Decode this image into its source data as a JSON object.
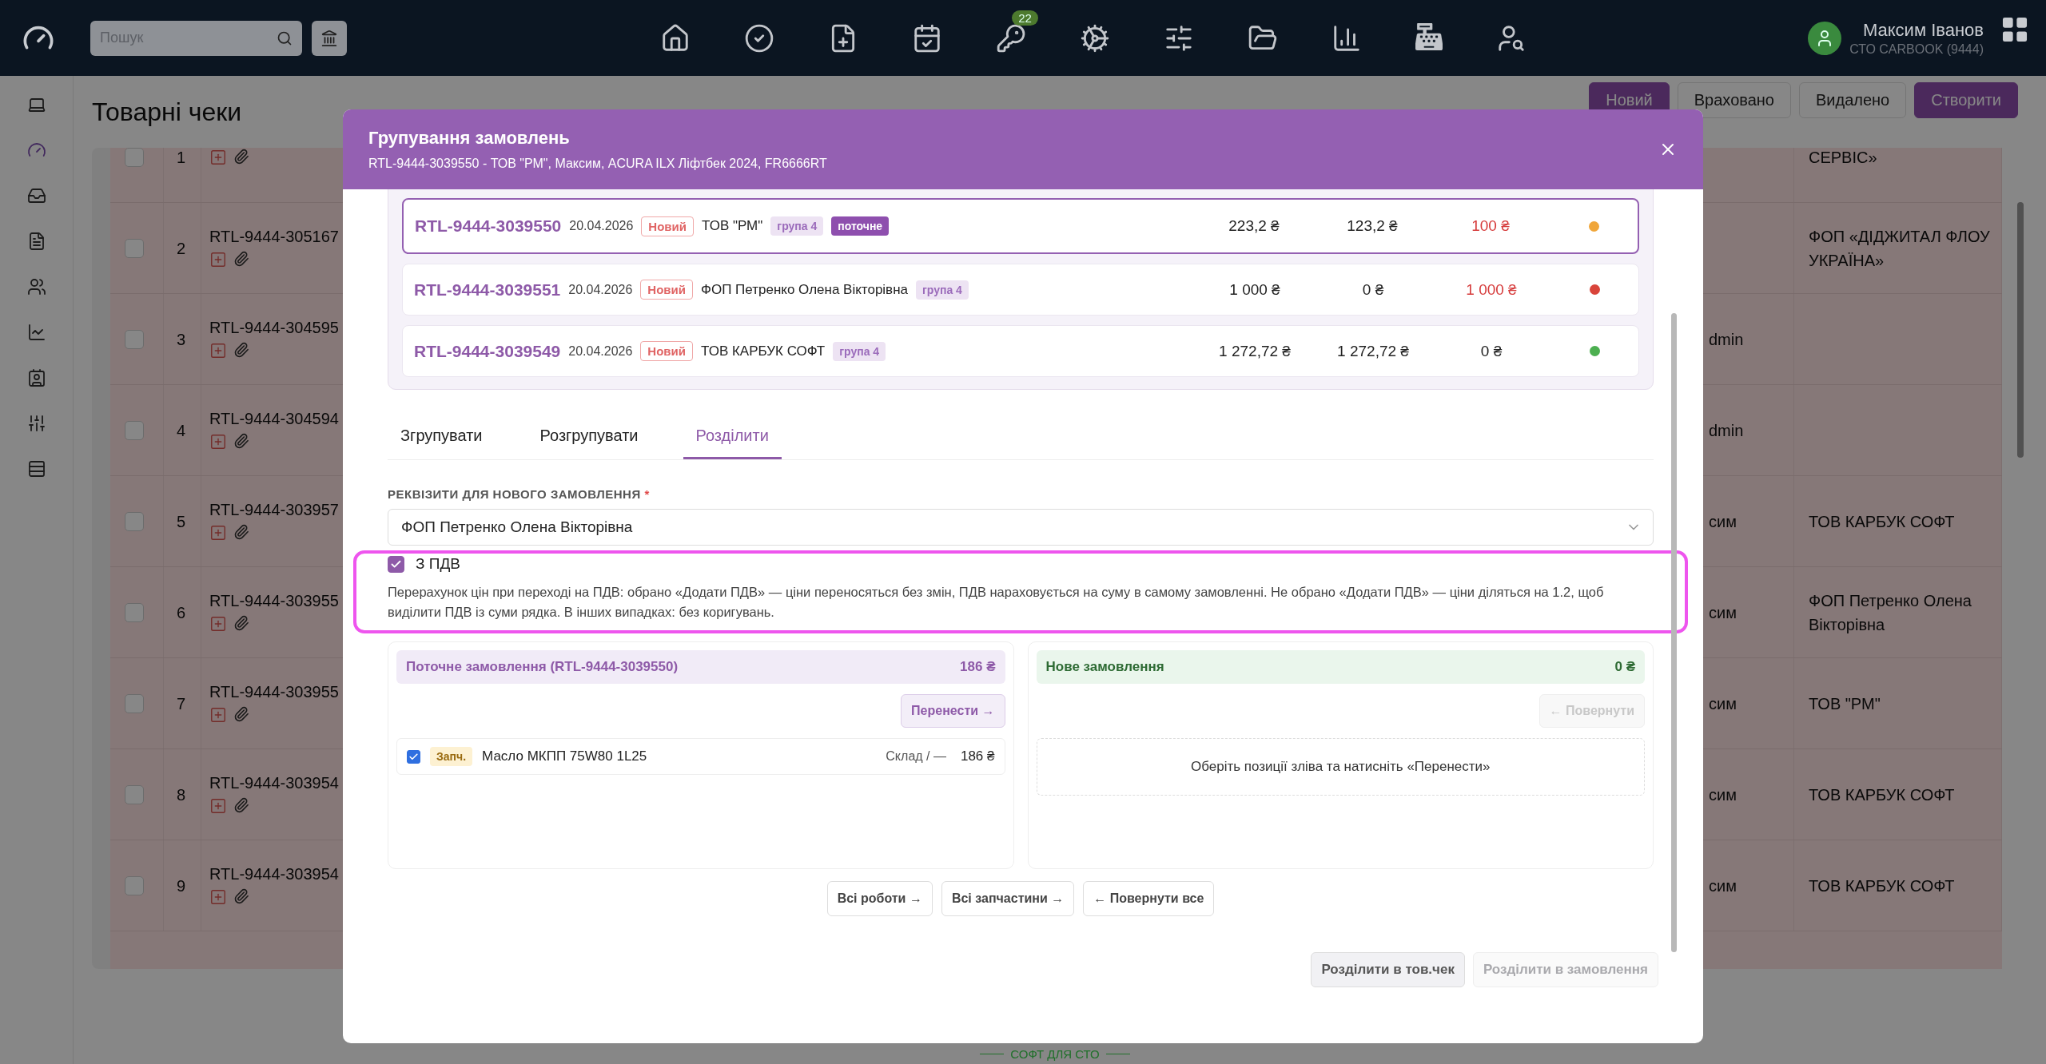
{
  "top_bar": {
    "search": {
      "placeholder": "Пошук"
    },
    "notification_count": "22",
    "user": {
      "name": "Максим Іванов",
      "company": "СТО CARBOOK (9444)"
    }
  },
  "sidebar": {
    "items": [
      {
        "selected": false
      },
      {
        "selected": true
      },
      {
        "selected": false
      },
      {
        "selected": false
      },
      {
        "selected": false
      },
      {
        "selected": false
      },
      {
        "selected": false
      },
      {
        "selected": false
      },
      {
        "selected": false
      }
    ]
  },
  "page": {
    "title": "Товарні чеки",
    "filters": [
      {
        "label": "Новий",
        "selected": true
      },
      {
        "label": "Враховано",
        "selected": false
      },
      {
        "label": "Видалено",
        "selected": false
      }
    ],
    "create_button": "Створити"
  },
  "table": {
    "rows": [
      {
        "number": "1",
        "checked": false,
        "column_5": "СЕРВІС»"
      },
      {
        "number": "2",
        "checked": false,
        "order": "RTL-9444-305167",
        "column_5": "ФОП «ДІДЖИТАЛ ФЛОУ УКРАЇНА»"
      },
      {
        "number": "3",
        "checked": false,
        "order": "RTL-9444-304595",
        "column_4": "dmin"
      },
      {
        "number": "4",
        "checked": false,
        "order": "RTL-9444-304594",
        "column_4": "dmin"
      },
      {
        "number": "5",
        "checked": false,
        "order": "RTL-9444-303957",
        "column_4": "сим",
        "column_5": "ТОВ КАРБУК СОФТ"
      },
      {
        "number": "6",
        "checked": false,
        "order": "RTL-9444-303955",
        "column_4": "сим",
        "column_5": "ФОП Петренко Олена Вікторівна"
      },
      {
        "number": "7",
        "checked": false,
        "order": "RTL-9444-303955",
        "column_4": "сим",
        "column_5": "ТОВ \"РМ\""
      },
      {
        "number": "8",
        "checked": false,
        "order": "RTL-9444-303954",
        "column_4": "сим",
        "column_5": "ТОВ КАРБУК СОФТ"
      },
      {
        "number": "9",
        "checked": false,
        "order": "RTL-9444-303954",
        "column_4": "сим",
        "column_5": "ТОВ КАРБУК СОФТ"
      }
    ]
  },
  "footer_text": "СОФТ ДЛЯ СТО",
  "modal": {
    "title": "Групування замовлень",
    "subtitle": "RTL-9444-3039550 - ТОВ \"РМ\", Максим, ACURA ILX Ліфтбек 2024, FR6666RT",
    "orders": [
      {
        "id": "RTL-9444-3039550",
        "date": "20.04.2026",
        "status": "Новий",
        "customer": "ТОВ \"РМ\"",
        "group": "група 4",
        "current_tag": "поточне",
        "selected": true,
        "amount": "223,2 ₴",
        "paid": "123,2 ₴",
        "debt": "100 ₴",
        "outstanding": true,
        "color": "#f0a63a"
      },
      {
        "id": "RTL-9444-3039551",
        "date": "20.04.2026",
        "status": "Новий",
        "customer": "ФОП Петренко Олена Вікторівна",
        "group": "група 4",
        "selected": false,
        "amount": "1 000 ₴",
        "paid": "0 ₴",
        "debt": "1 000 ₴",
        "outstanding": true,
        "color": "#d9443a"
      },
      {
        "id": "RTL-9444-3039549",
        "date": "20.04.2026",
        "status": "Новий",
        "customer": "ТОВ КАРБУК СОФТ",
        "group": "група 4",
        "selected": false,
        "amount": "1 272,72 ₴",
        "paid": "1 272,72 ₴",
        "debt": "0 ₴",
        "outstanding": false,
        "color": "#4caf50"
      }
    ],
    "tabs": [
      {
        "label": "Згрупувати",
        "selected": false
      },
      {
        "label": "Розгрупувати",
        "selected": false
      },
      {
        "label": "Розділити",
        "selected": true
      }
    ],
    "requisites": {
      "label": "РЕКВІЗИТИ ДЛЯ НОВОГО ЗАМОВЛЕННЯ",
      "required_mark": "*",
      "value": "ФОП Петренко Олена Вікторівна"
    },
    "vat": {
      "label": "З ПДВ",
      "checked": true,
      "highlighted": true,
      "note": "Перерахунок цін при переході на ПДВ: обрано «Додати ПДВ» — ціни переносяться без змін, ПДВ нараховується на суму в самому замовленні. Не обрано «Додати ПДВ» — ціни діляться на 1.2, щоб виділити ПДВ із суми рядка. В інших випадках: без коригувань."
    },
    "current_order": {
      "title": "Поточне замовлення (RTL-9444-3039550)",
      "total": "186 ₴",
      "move_button": {
        "label": "Перенести →",
        "disabled": false
      },
      "items": [
        {
          "checked": true,
          "tag": "Запч.",
          "name": "Масло МКПП 75W80 1L25",
          "stock": "Склад / —",
          "price": "186 ₴"
        }
      ]
    },
    "new_order": {
      "title": "Нове замовлення",
      "total": "0 ₴",
      "return_button": {
        "label": "← Повернути",
        "disabled": true
      },
      "empty_hint": "Оберіть позиції зліва та натисніть «Перенести»"
    },
    "bulk_buttons": [
      "Всі роботи →",
      "Всі запчастини →",
      "← Повернути все"
    ],
    "footer_buttons": [
      {
        "label": "Розділити в тов.чек",
        "disabled": false
      },
      {
        "label": "Розділити в замовлення",
        "disabled": true
      }
    ]
  }
}
